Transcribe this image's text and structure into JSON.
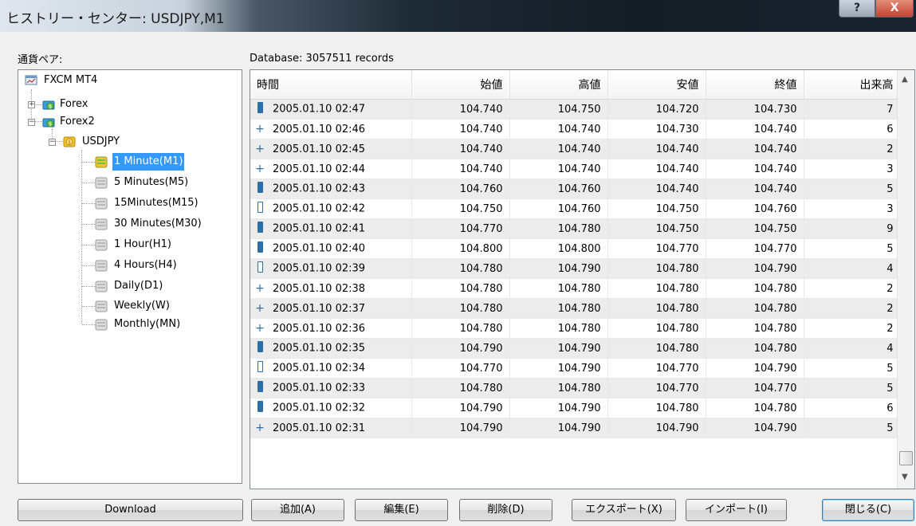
{
  "window": {
    "title": "ヒストリー・センター: USDJPY,M1",
    "help_button": "?",
    "close_button": "X"
  },
  "left_label": "通貨ペア:",
  "db_label": "Database: 3057511 records",
  "tree": {
    "root": "FXCM MT4",
    "forex": "Forex",
    "forex2": "Forex2",
    "symbol": "USDJPY",
    "timeframes": [
      "1 Minute(M1)",
      "5 Minutes(M5)",
      "15Minutes(M15)",
      "30 Minutes(M30)",
      "1 Hour(H1)",
      "4 Hours(H4)",
      "Daily(D1)",
      "Weekly(W)",
      "Monthly(MN)"
    ]
  },
  "table": {
    "headers": [
      "時間",
      "始値",
      "高値",
      "安値",
      "終値",
      "出来高"
    ],
    "rows": [
      {
        "type": "bear",
        "time": "2005.01.10 02:47",
        "open": "104.740",
        "high": "104.750",
        "low": "104.720",
        "close": "104.730",
        "volume": "7"
      },
      {
        "type": "doji",
        "time": "2005.01.10 02:46",
        "open": "104.740",
        "high": "104.740",
        "low": "104.730",
        "close": "104.740",
        "volume": "6"
      },
      {
        "type": "doji",
        "time": "2005.01.10 02:45",
        "open": "104.740",
        "high": "104.740",
        "low": "104.740",
        "close": "104.740",
        "volume": "2"
      },
      {
        "type": "doji",
        "time": "2005.01.10 02:44",
        "open": "104.740",
        "high": "104.740",
        "low": "104.740",
        "close": "104.740",
        "volume": "3"
      },
      {
        "type": "bear",
        "time": "2005.01.10 02:43",
        "open": "104.760",
        "high": "104.760",
        "low": "104.740",
        "close": "104.740",
        "volume": "5"
      },
      {
        "type": "bull",
        "time": "2005.01.10 02:42",
        "open": "104.750",
        "high": "104.760",
        "low": "104.750",
        "close": "104.760",
        "volume": "3"
      },
      {
        "type": "bear",
        "time": "2005.01.10 02:41",
        "open": "104.770",
        "high": "104.780",
        "low": "104.750",
        "close": "104.750",
        "volume": "9"
      },
      {
        "type": "bear",
        "time": "2005.01.10 02:40",
        "open": "104.800",
        "high": "104.800",
        "low": "104.770",
        "close": "104.770",
        "volume": "5"
      },
      {
        "type": "bull",
        "time": "2005.01.10 02:39",
        "open": "104.780",
        "high": "104.790",
        "low": "104.780",
        "close": "104.790",
        "volume": "4"
      },
      {
        "type": "doji",
        "time": "2005.01.10 02:38",
        "open": "104.780",
        "high": "104.780",
        "low": "104.780",
        "close": "104.780",
        "volume": "2"
      },
      {
        "type": "doji",
        "time": "2005.01.10 02:37",
        "open": "104.780",
        "high": "104.780",
        "low": "104.780",
        "close": "104.780",
        "volume": "2"
      },
      {
        "type": "doji",
        "time": "2005.01.10 02:36",
        "open": "104.780",
        "high": "104.780",
        "low": "104.780",
        "close": "104.780",
        "volume": "2"
      },
      {
        "type": "bear",
        "time": "2005.01.10 02:35",
        "open": "104.790",
        "high": "104.790",
        "low": "104.780",
        "close": "104.780",
        "volume": "4"
      },
      {
        "type": "bull",
        "time": "2005.01.10 02:34",
        "open": "104.770",
        "high": "104.790",
        "low": "104.770",
        "close": "104.790",
        "volume": "5"
      },
      {
        "type": "bear",
        "time": "2005.01.10 02:33",
        "open": "104.780",
        "high": "104.780",
        "low": "104.770",
        "close": "104.770",
        "volume": "5"
      },
      {
        "type": "bear",
        "time": "2005.01.10 02:32",
        "open": "104.790",
        "high": "104.790",
        "low": "104.780",
        "close": "104.780",
        "volume": "6"
      },
      {
        "type": "doji",
        "time": "2005.01.10 02:31",
        "open": "104.790",
        "high": "104.790",
        "low": "104.790",
        "close": "104.790",
        "volume": "5"
      }
    ]
  },
  "buttons": {
    "download": "Download",
    "add": "追加(A)",
    "edit": "編集(E)",
    "delete": "削除(D)",
    "export": "エクスポート(X)",
    "import": "インポート(I)",
    "close": "閉じる(C)"
  }
}
